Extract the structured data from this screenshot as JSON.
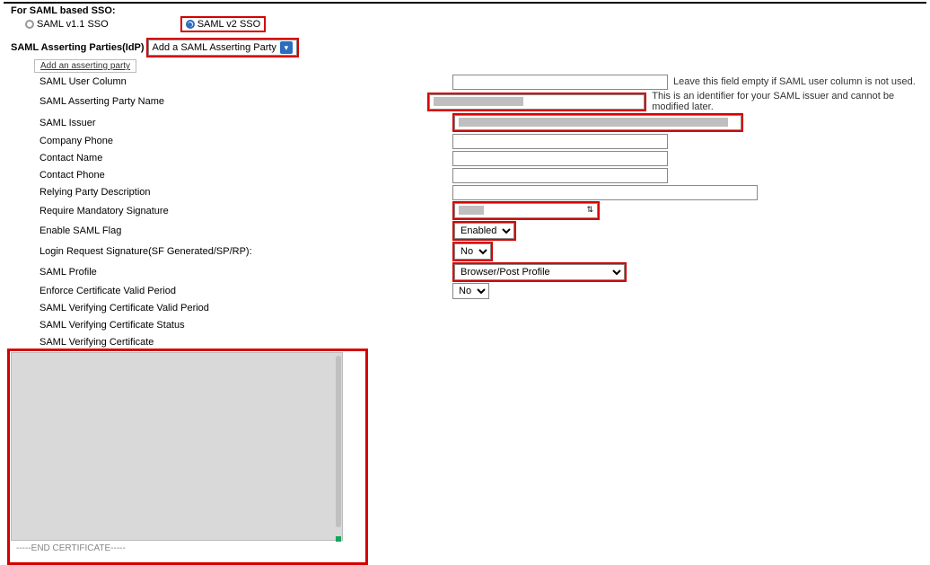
{
  "header": {
    "title": "For SAML based SSO:"
  },
  "radio": {
    "v1_label": "SAML v1.1 SSO",
    "v2_label": "SAML v2 SSO",
    "selected": "v2"
  },
  "asserting": {
    "heading": "SAML Asserting Parties(IdP)",
    "dropdown_selected": "Add a SAML Asserting Party",
    "add_link": "Add an asserting party"
  },
  "fields": {
    "user_column": {
      "label": "SAML User Column",
      "hint": "Leave this field empty if SAML user column is not used."
    },
    "party_name": {
      "label": "SAML Asserting Party Name",
      "hint": "This is an identifier for your SAML issuer and cannot be modified later."
    },
    "issuer": {
      "label": "SAML Issuer"
    },
    "company_phone": {
      "label": "Company Phone"
    },
    "contact_name": {
      "label": "Contact Name"
    },
    "contact_phone": {
      "label": "Contact Phone"
    },
    "relying_desc": {
      "label": "Relying Party Description"
    },
    "require_sig": {
      "label": "Require Mandatory Signature",
      "value": ""
    },
    "enable_flag": {
      "label": "Enable SAML Flag",
      "value": "Enabled"
    },
    "login_sig": {
      "label": "Login Request Signature(SF Generated/SP/RP):",
      "value": "No"
    },
    "profile": {
      "label": "SAML Profile",
      "value": "Browser/Post Profile"
    },
    "enforce_cert": {
      "label": "Enforce Certificate Valid Period",
      "value": "No"
    },
    "cert_valid_period": {
      "label": "SAML Verifying Certificate Valid Period"
    },
    "cert_status": {
      "label": "SAML Verifying Certificate Status"
    },
    "cert": {
      "label": "SAML Verifying Certificate",
      "end_line": "-----END CERTIFICATE-----"
    }
  }
}
